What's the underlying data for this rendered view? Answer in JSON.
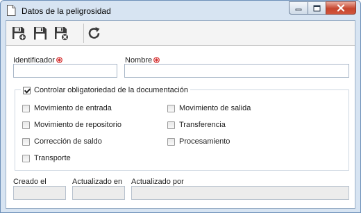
{
  "window": {
    "title": "Datos de la peligrosidad"
  },
  "toolbar": {
    "buttons": [
      {
        "icon": "save-new-icon"
      },
      {
        "icon": "save-icon"
      },
      {
        "icon": "save-close-icon"
      },
      {
        "icon": "refresh-icon"
      }
    ]
  },
  "form": {
    "identificador": {
      "label": "Identificador",
      "value": ""
    },
    "nombre": {
      "label": "Nombre",
      "value": ""
    },
    "required_color": "#d42a2a",
    "group": {
      "legend": "Controlar obligatoriedad de la documentación",
      "legend_checked": true,
      "options_left": [
        {
          "label": "Movimiento de entrada",
          "checked": false
        },
        {
          "label": "Movimiento de repositorio",
          "checked": false
        },
        {
          "label": "Corrección de saldo",
          "checked": false
        },
        {
          "label": "Transporte",
          "checked": false
        }
      ],
      "options_right": [
        {
          "label": "Movimiento de salida",
          "checked": false
        },
        {
          "label": "Transferencia",
          "checked": false
        },
        {
          "label": "Procesamiento",
          "checked": false
        }
      ]
    },
    "creado_el": {
      "label": "Creado el",
      "value": ""
    },
    "actualizado_en": {
      "label": "Actualizado en",
      "value": ""
    },
    "actualizado_por": {
      "label": "Actualizado por",
      "value": ""
    }
  }
}
